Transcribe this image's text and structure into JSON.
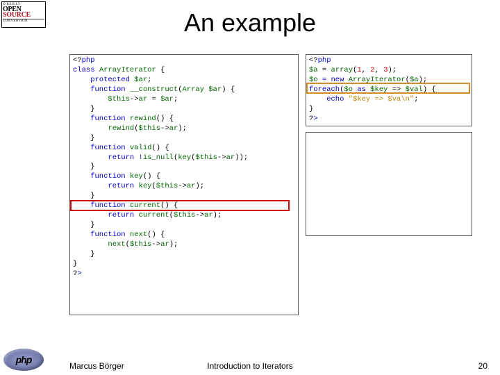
{
  "logo_oscon": {
    "top": "O'REILLY",
    "open": "OPEN",
    "source": "SOURCE",
    "conv": "CONVENTION"
  },
  "logo_php": "php",
  "title": "An example",
  "code_left": {
    "l01a": "<?",
    "l01b": "php",
    "l02a": "class ",
    "l02b": "ArrayIterator ",
    "l02c": "{",
    "l03a": "    protected ",
    "l03b": "$ar",
    "l03c": ";",
    "l04a": "    function ",
    "l04b": "__construct",
    "l04c": "(",
    "l04d": "Array $ar",
    "l04e": ") {",
    "l05a": "        ",
    "l05b": "$this",
    "l05c": "->",
    "l05d": "ar ",
    "l05e": "= ",
    "l05f": "$ar",
    "l05g": ";",
    "l06": "    }",
    "l07a": "    function ",
    "l07b": "rewind",
    "l07c": "() {",
    "l08a": "        ",
    "l08b": "rewind",
    "l08c": "(",
    "l08d": "$this",
    "l08e": "->",
    "l08f": "ar",
    "l08g": ");",
    "l09": "    }",
    "l10a": "    function ",
    "l10b": "valid",
    "l10c": "() {",
    "l11a": "        return !",
    "l11b": "is_null",
    "l11c": "(",
    "l11d": "key",
    "l11e": "(",
    "l11f": "$this",
    "l11g": "->",
    "l11h": "ar",
    "l11i": "));",
    "l12": "    }",
    "l13a": "    function ",
    "l13b": "key",
    "l13c": "() {",
    "l14a": "        return ",
    "l14b": "key",
    "l14c": "(",
    "l14d": "$this",
    "l14e": "->",
    "l14f": "ar",
    "l14g": ");",
    "l15": "    }",
    "l16a": "    function ",
    "l16b": "current",
    "l16c": "() {",
    "l17a": "        return ",
    "l17b": "current",
    "l17c": "(",
    "l17d": "$this",
    "l17e": "->",
    "l17f": "ar",
    "l17g": ");",
    "l18": "    }",
    "l19a": "    function ",
    "l19b": "next",
    "l19c": "() {",
    "l20a": "        ",
    "l20b": "next",
    "l20c": "(",
    "l20d": "$this",
    "l20e": "->",
    "l20f": "ar",
    "l20g": ");",
    "l21": "    }",
    "l22": "}",
    "l23a": "?",
    "l23b": ">"
  },
  "code_right": {
    "r01a": "<?",
    "r01b": "php",
    "r02a": "$a ",
    "r02b": "= ",
    "r02c": "array",
    "r02d": "(",
    "r02e": "1",
    "r02f": ", ",
    "r02g": "2",
    "r02h": ", ",
    "r02i": "3",
    "r02j": ");",
    "r03a": "$o ",
    "r03b": "= new ",
    "r03c": "ArrayIterator",
    "r03d": "(",
    "r03e": "$a",
    "r03f": ");",
    "r04a": "foreach(",
    "r04b": "$o ",
    "r04c": "as ",
    "r04d": "$key ",
    "r04e": "=> ",
    "r04f": "$val",
    "r04g": ") {",
    "r05a": "    echo ",
    "r05b": "\"$key => $va\\n\"",
    "r05c": ";",
    "r06": "}",
    "r07a": "?",
    "r07b": ">"
  },
  "footer": {
    "author": "Marcus Börger",
    "center": "Introduction to Iterators",
    "page": "20"
  }
}
